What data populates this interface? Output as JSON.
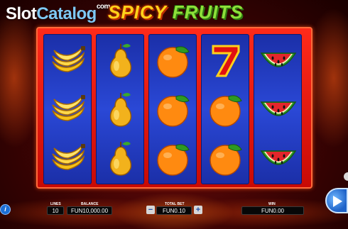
{
  "watermark": {
    "part1": "Slot",
    "part2": "Catalog",
    "suffix": "com"
  },
  "game": {
    "logo_part1": "SPICY",
    "logo_part2": "FRUITS"
  },
  "reels": [
    [
      "banana",
      "banana",
      "banana"
    ],
    [
      "pear",
      "pear",
      "pear"
    ],
    [
      "orange",
      "orange",
      "orange"
    ],
    [
      "seven",
      "orange",
      "orange"
    ],
    [
      "watermelon",
      "watermelon",
      "watermelon"
    ]
  ],
  "controls": {
    "lines_label": "LINES",
    "lines_value": "10",
    "balance_label": "BALANCE",
    "balance_value": "FUN10,000.00",
    "total_bet_label": "TOTAL BET",
    "total_bet_value": "FUN0.10",
    "minus": "−",
    "plus": "+",
    "win_label": "WIN",
    "win_value": "FUN0.00",
    "info": "i"
  },
  "icons": {
    "info": "info-icon",
    "spin": "play-icon"
  },
  "colors": {
    "frame": "#e0160c",
    "reel": "#2a48d6",
    "spin": "#1f63c8"
  }
}
